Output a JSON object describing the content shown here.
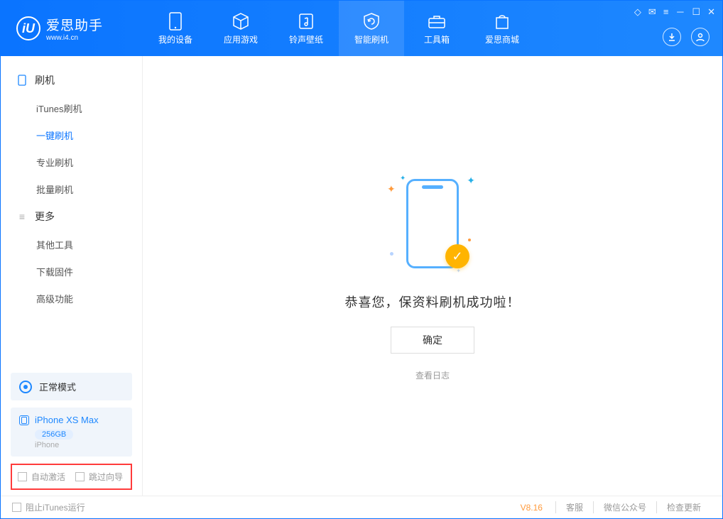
{
  "app": {
    "title": "爱思助手",
    "subtitle": "www.i4.cn",
    "logo_letter": "iU"
  },
  "nav": [
    {
      "label": "我的设备",
      "icon": "device"
    },
    {
      "label": "应用游戏",
      "icon": "cube"
    },
    {
      "label": "铃声壁纸",
      "icon": "music"
    },
    {
      "label": "智能刷机",
      "icon": "refresh",
      "active": true
    },
    {
      "label": "工具箱",
      "icon": "toolbox"
    },
    {
      "label": "爱思商城",
      "icon": "bag"
    }
  ],
  "sidebar": {
    "group1": {
      "title": "刷机",
      "items": [
        "iTunes刷机",
        "一键刷机",
        "专业刷机",
        "批量刷机"
      ],
      "active_index": 1
    },
    "group2": {
      "title": "更多",
      "items": [
        "其他工具",
        "下载固件",
        "高级功能"
      ]
    }
  },
  "mode": {
    "label": "正常模式"
  },
  "device": {
    "name": "iPhone XS Max",
    "capacity": "256GB",
    "brand": "iPhone"
  },
  "checkboxes": {
    "auto_activate": "自动激活",
    "skip_wizard": "跳过向导"
  },
  "main": {
    "success_message": "恭喜您，保资料刷机成功啦！",
    "ok_button": "确定",
    "view_log": "查看日志"
  },
  "footer": {
    "block_itunes": "阻止iTunes运行",
    "version": "V8.16",
    "links": [
      "客服",
      "微信公众号",
      "检查更新"
    ]
  }
}
